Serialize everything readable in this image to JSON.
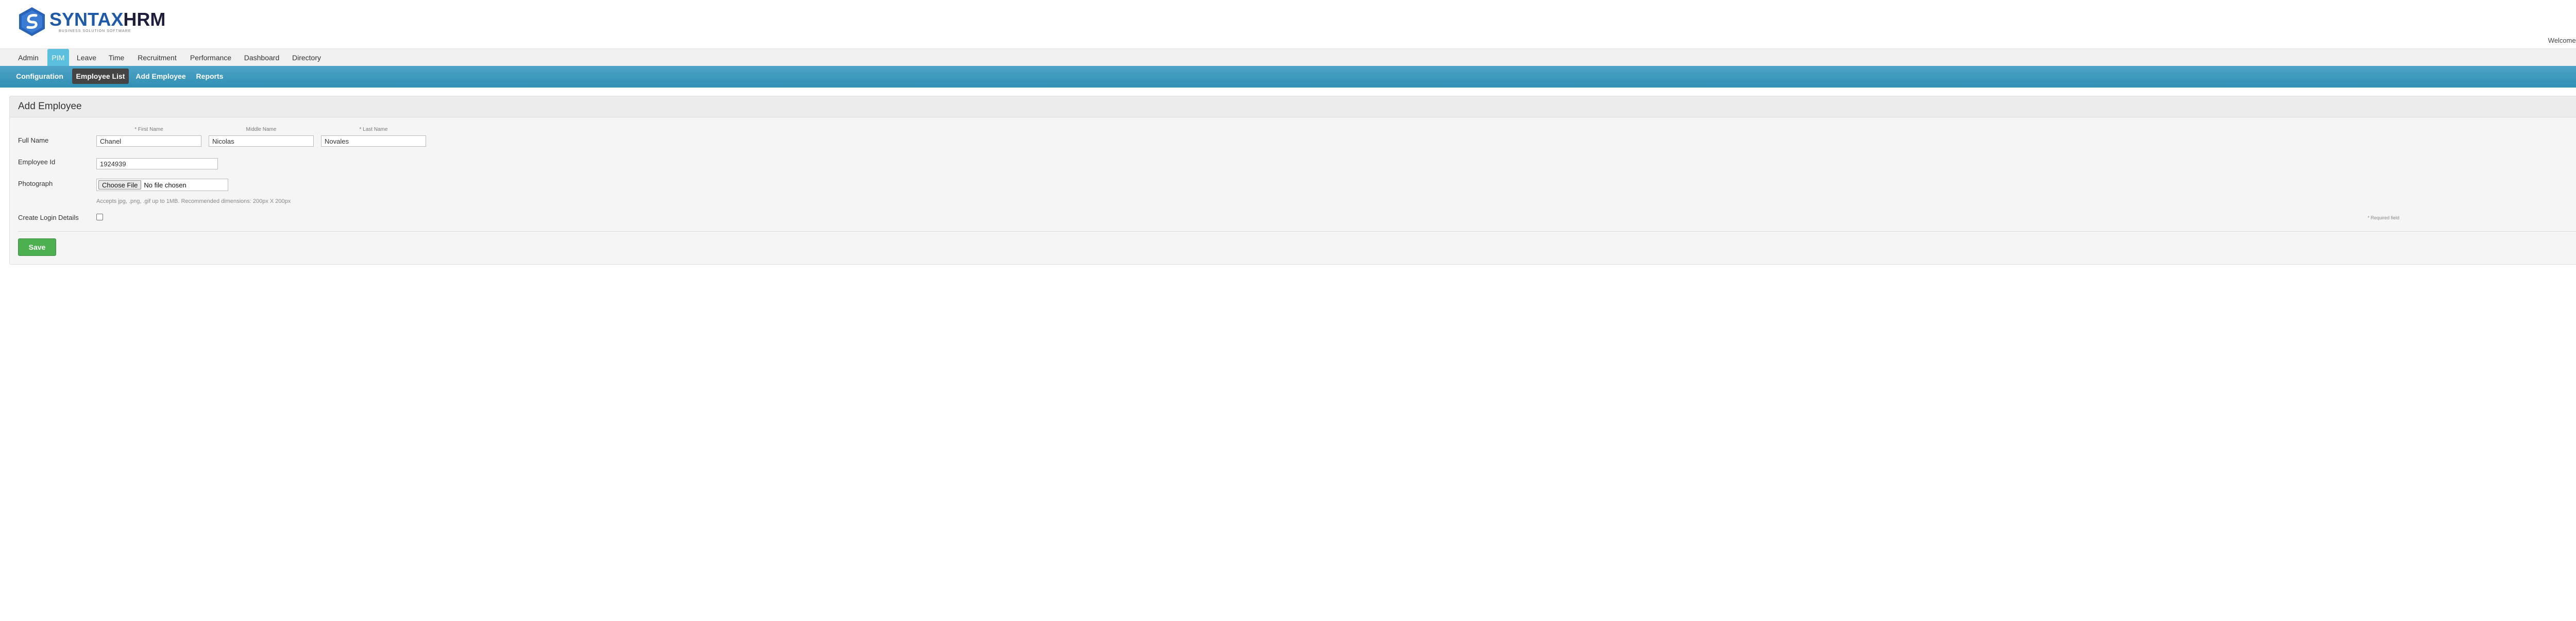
{
  "brand": {
    "name_part1": "SYNTAX",
    "name_part2": "HRM",
    "tagline": "BUSINESS SOLUTION SOFTWARE"
  },
  "header": {
    "welcome": "Welcome Admin",
    "user_icon": "users-icon"
  },
  "topnav": {
    "active": "PIM",
    "items": [
      "Admin",
      "PIM",
      "Leave",
      "Time",
      "Recruitment",
      "Performance",
      "Dashboard",
      "Directory"
    ]
  },
  "subnav": {
    "active": "Employee List",
    "items": [
      "Configuration",
      "Employee List",
      "Add Employee",
      "Reports"
    ]
  },
  "form": {
    "title": "Add Employee",
    "full_name_label": "Full Name",
    "first_name_label": "* First Name",
    "middle_name_label": "Middle Name",
    "last_name_label": "* Last Name",
    "first_name_value": "Chanel",
    "middle_name_value": "Nicolas",
    "last_name_value": "Novales",
    "employee_id_label": "Employee Id",
    "employee_id_value": "1924939",
    "photograph_label": "Photograph",
    "choose_file_label": "Choose File",
    "file_status": "No file chosen",
    "file_hint": "Accepts jpg, .png, .gif up to 1MB. Recommended dimensions: 200px X 200px",
    "create_login_label": "Create Login Details",
    "create_login_checked": false,
    "required_note": "* Required field",
    "save_label": "Save"
  },
  "colors": {
    "accent": "#5bc0de",
    "subnav": "#3a98bd",
    "save": "#4caf50",
    "brand_blue": "#1f5aa8"
  }
}
